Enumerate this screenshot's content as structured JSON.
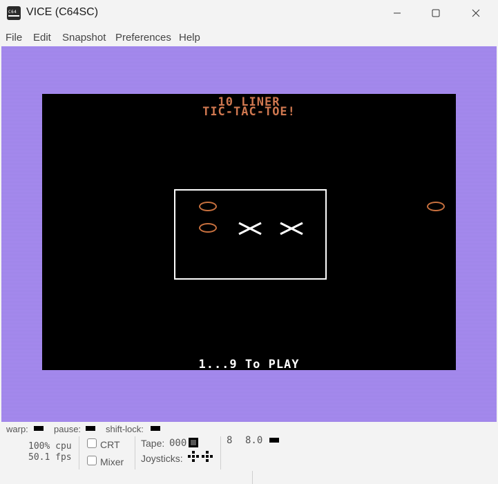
{
  "window": {
    "title": "VICE (C64SC)",
    "icon": "vice-c64-icon",
    "icon_text": "C64",
    "controls": [
      "minimize-icon",
      "maximize-icon",
      "close-icon"
    ]
  },
  "menu": {
    "items": [
      "File",
      "Edit",
      "Snapshot",
      "Preferences",
      "Help"
    ]
  },
  "game": {
    "border_color": "#a78df0",
    "background_color": "#000000",
    "heading_line1": "10 LINER",
    "heading_line2": "TIC-TAC-TOE!",
    "prompt": "1...9 To PLAY",
    "text_color": "#d07850",
    "prompt_color": "#ffffff",
    "o_color": "#c8703e",
    "x_color": "#ffffff",
    "marks": [
      "O",
      "O",
      "X",
      "X",
      "O"
    ]
  },
  "status": {
    "warp_label": "warp:",
    "pause_label": "pause:",
    "shiftlock_label": "shift-lock:",
    "cpu": "100% cpu",
    "fps": "50.1 fps",
    "crt_label": "CRT",
    "mixer_label": "Mixer",
    "crt_checked": false,
    "mixer_checked": false,
    "tape_label": "Tape:",
    "tape_counter": "000",
    "joysticks_label": "Joysticks:",
    "drive_number": "8",
    "drive_track": "8.0"
  }
}
